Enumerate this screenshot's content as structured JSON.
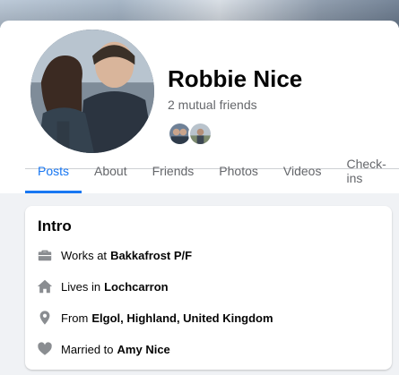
{
  "profile": {
    "name": "Robbie Nice",
    "mutual_friends": "2 mutual friends"
  },
  "tabs": [
    {
      "label": "Posts",
      "active": true
    },
    {
      "label": "About",
      "active": false
    },
    {
      "label": "Photos",
      "active": false
    },
    {
      "label": "Friends",
      "active": false
    },
    {
      "label": "Videos",
      "active": false
    },
    {
      "label": "Check-ins",
      "active": false
    }
  ],
  "tabs_order": [
    "Posts",
    "About",
    "Friends",
    "Photos",
    "Videos",
    "Check-ins"
  ],
  "intro": {
    "title": "Intro",
    "items": [
      {
        "icon": "briefcase-icon",
        "prefix": "Works at",
        "value": "Bakkafrost P/F"
      },
      {
        "icon": "home-icon",
        "prefix": "Lives in",
        "value": "Lochcarron"
      },
      {
        "icon": "location-pin-icon",
        "prefix": "From",
        "value": "Elgol, Highland, United Kingdom"
      },
      {
        "icon": "heart-icon",
        "prefix": "Married to",
        "value": "Amy Nice"
      }
    ]
  },
  "colors": {
    "accent": "#1877f2",
    "secondary_text": "#65676b",
    "background": "#f0f2f5",
    "icon": "#8a8d91"
  }
}
